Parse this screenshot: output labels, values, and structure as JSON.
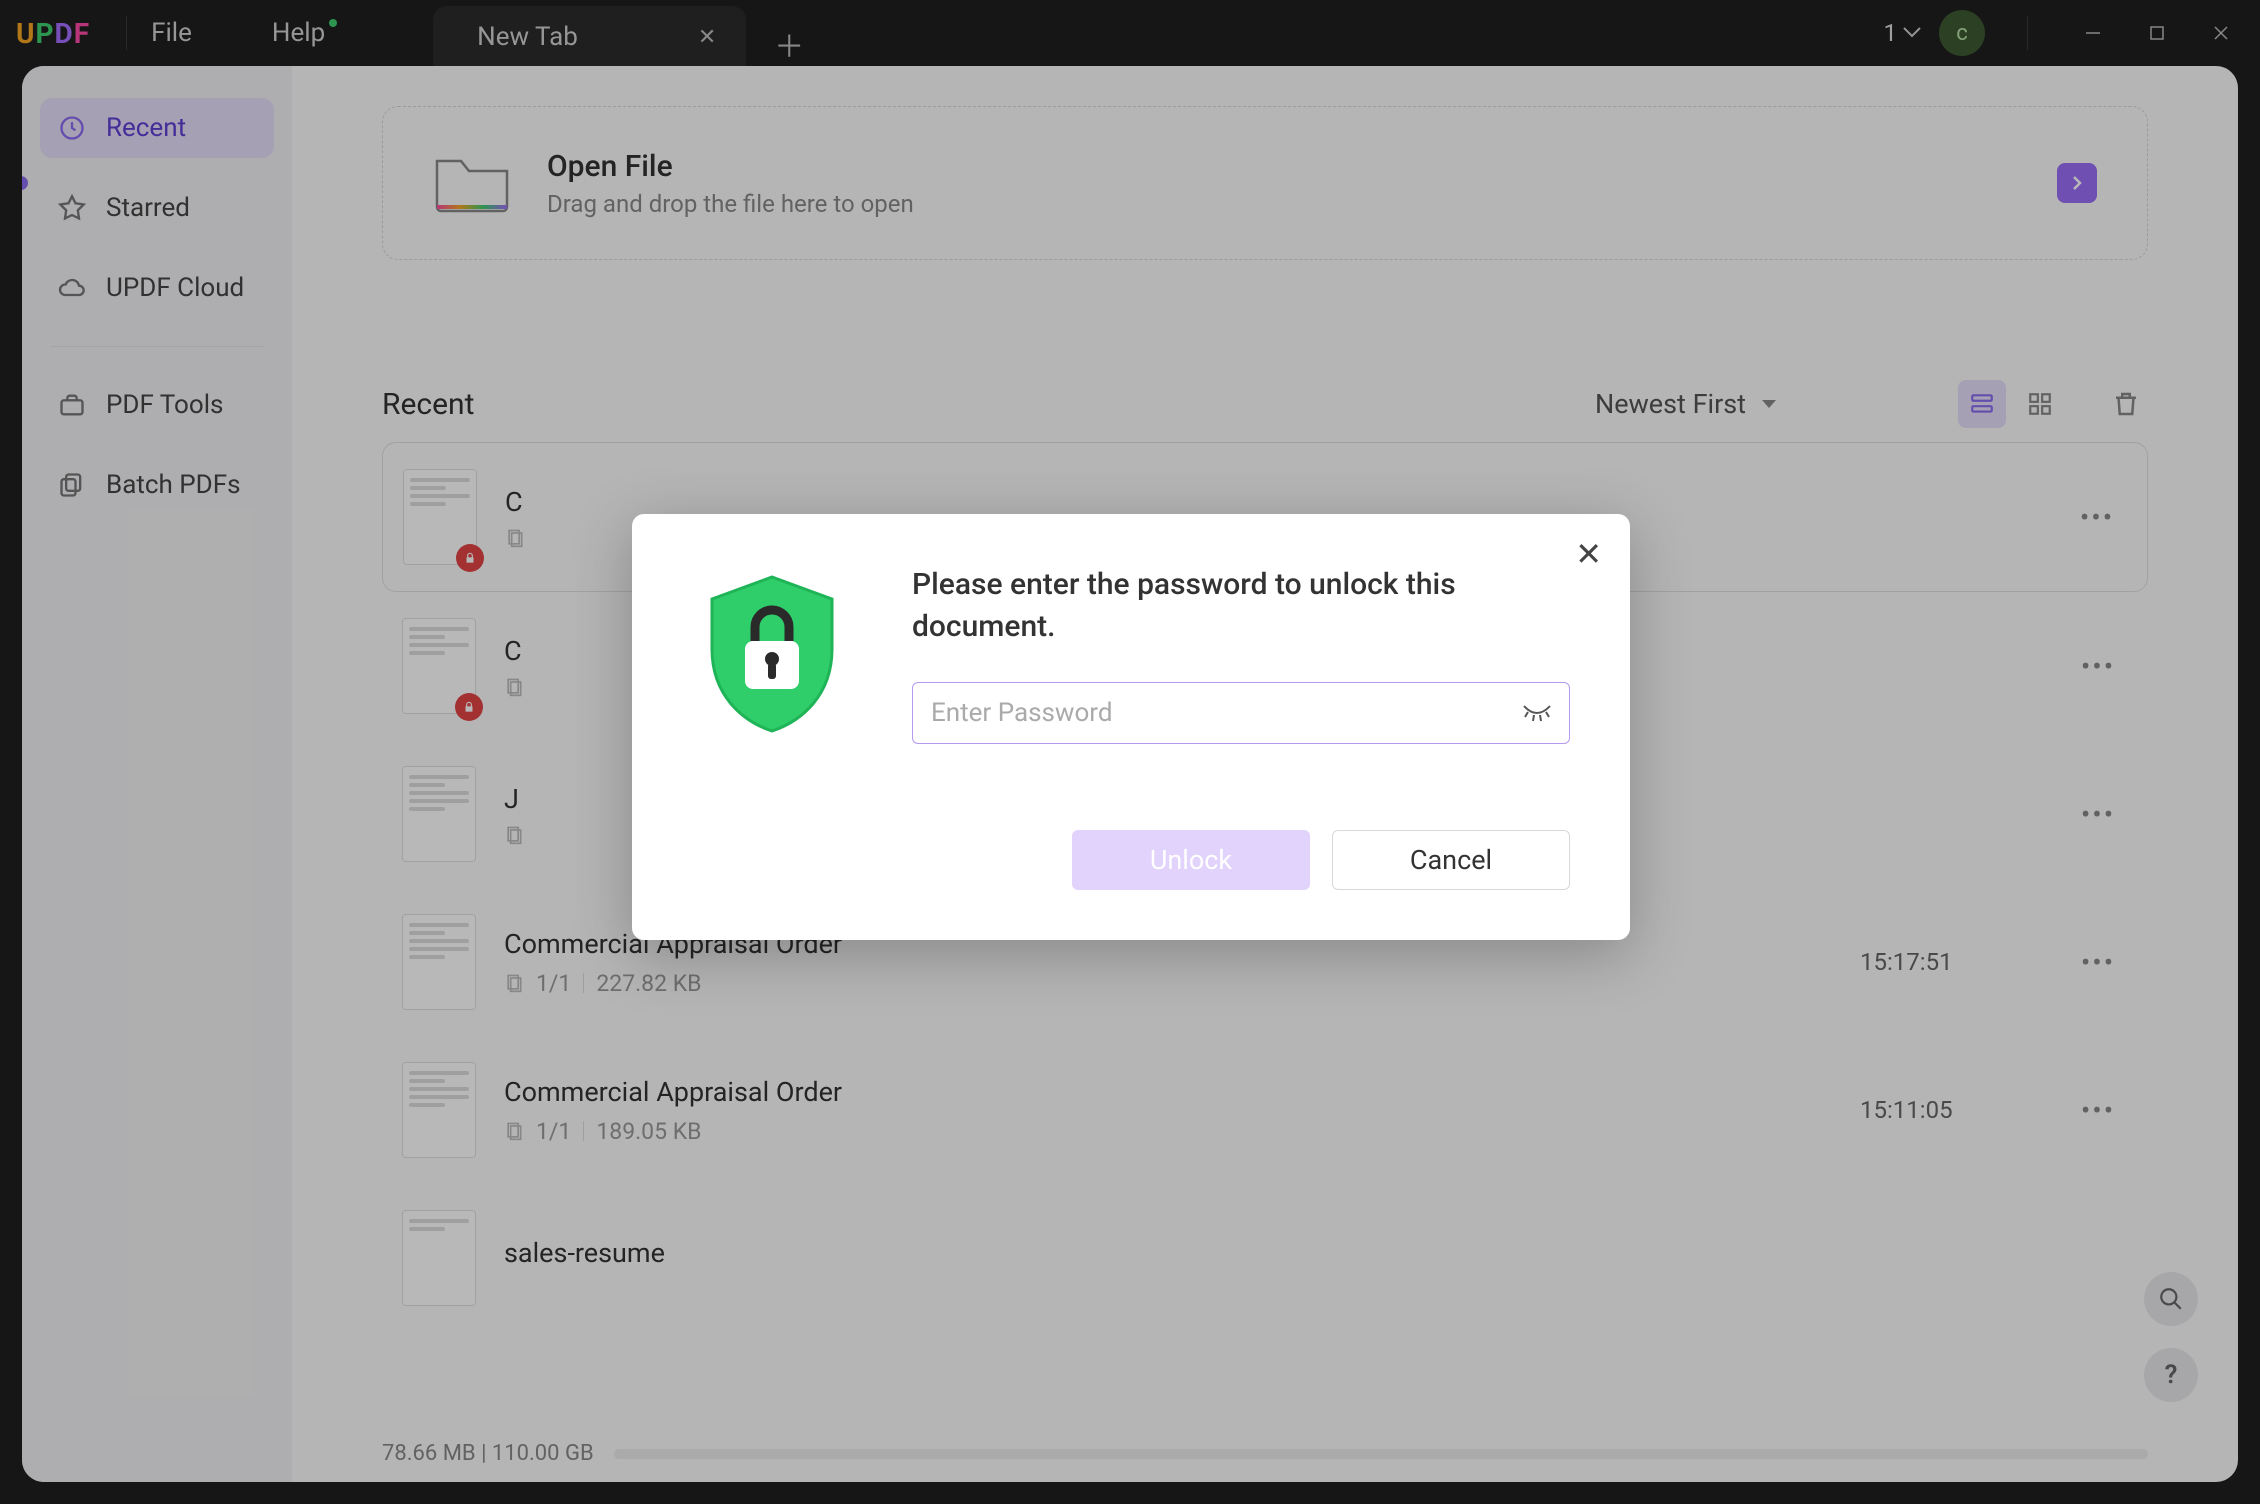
{
  "titlebar": {
    "logo": {
      "u": "U",
      "p": "P",
      "d": "D",
      "f": "F"
    },
    "file_menu": "File",
    "help_menu": "Help",
    "tab_label": "New Tab",
    "tab_count": "1",
    "avatar_letter": "c"
  },
  "sidebar": {
    "recent": "Recent",
    "starred": "Starred",
    "cloud": "UPDF Cloud",
    "tools": "PDF Tools",
    "batch": "Batch PDFs"
  },
  "open_box": {
    "title": "Open File",
    "subtitle": "Drag and drop the file here to open"
  },
  "recent_section": {
    "heading": "Recent",
    "sort_label": "Newest First"
  },
  "files": [
    {
      "name": "C",
      "pages": "",
      "size": "",
      "time": "",
      "locked": true
    },
    {
      "name": "C",
      "pages": "",
      "size": "",
      "time": "",
      "locked": true
    },
    {
      "name": "J",
      "pages": "",
      "size": "",
      "time": "",
      "locked": false
    },
    {
      "name": "Commercial Appraisal Order",
      "pages": "1/1",
      "size": "227.82 KB",
      "time": "15:17:51",
      "locked": false
    },
    {
      "name": "Commercial Appraisal Order",
      "pages": "1/1",
      "size": "189.05 KB",
      "time": "15:11:05",
      "locked": false
    },
    {
      "name": "sales-resume",
      "pages": "",
      "size": "",
      "time": "",
      "locked": false
    }
  ],
  "footer": {
    "storage": "78.66 MB | 110.00 GB"
  },
  "dialog": {
    "message": "Please enter the password to unlock this document.",
    "placeholder": "Enter Password",
    "unlock": "Unlock",
    "cancel": "Cancel"
  }
}
